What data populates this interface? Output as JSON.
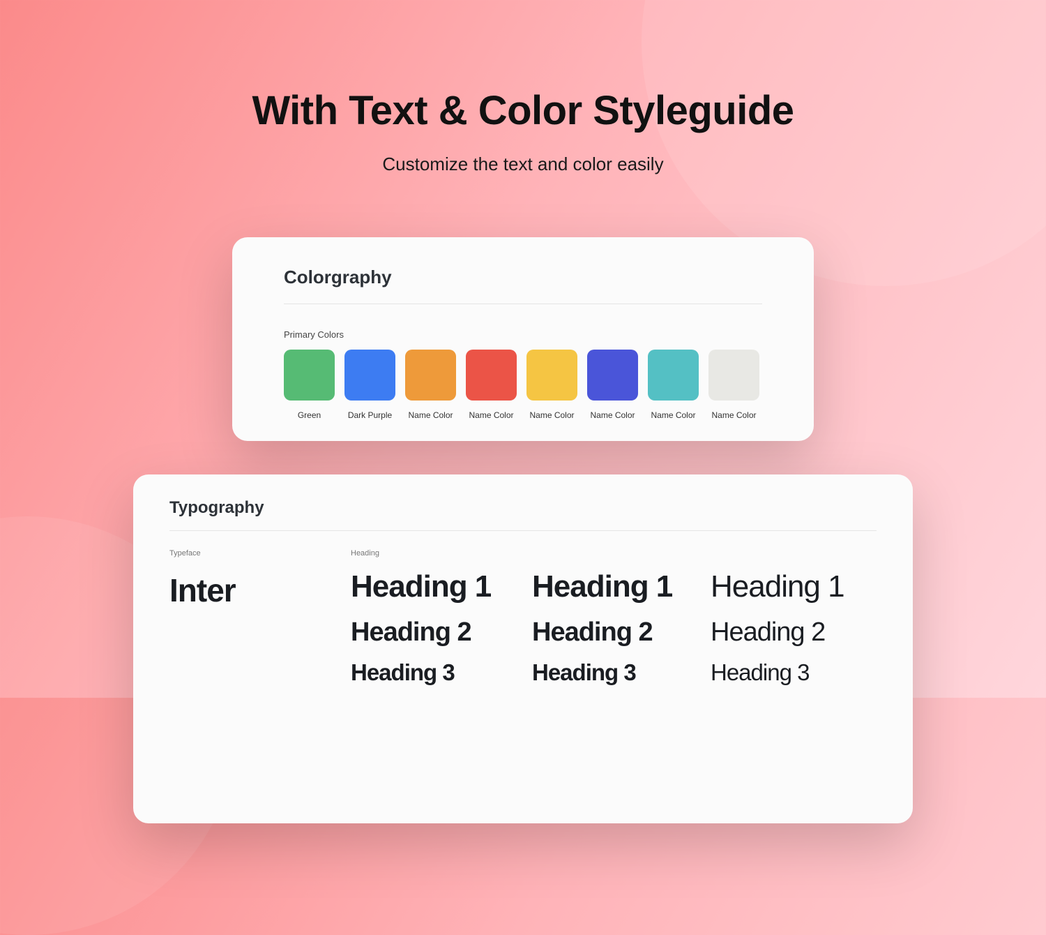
{
  "hero": {
    "title": "With Text & Color Styleguide",
    "subtitle": "Customize the text and color easily"
  },
  "colorgraphy": {
    "title": "Colorgraphy",
    "section_label": "Primary Colors",
    "swatches": [
      {
        "name": "Green",
        "hex": "#56bb74"
      },
      {
        "name": "Dark Purple",
        "hex": "#3d7cf2"
      },
      {
        "name": "Name Color",
        "hex": "#ee9a3a"
      },
      {
        "name": "Name Color",
        "hex": "#eb5447"
      },
      {
        "name": "Name Color",
        "hex": "#f5c543"
      },
      {
        "name": "Name Color",
        "hex": "#4a55d9"
      },
      {
        "name": "Name Color",
        "hex": "#54c0c4"
      },
      {
        "name": "Name Color",
        "hex": "#e8e8e4"
      }
    ]
  },
  "typography": {
    "title": "Typography",
    "typeface_label": "Typeface",
    "typeface_name": "Inter",
    "heading_label": "Heading",
    "samples": {
      "h1": "Heading 1",
      "h2": "Heading 2",
      "h3": "Heading 3"
    }
  }
}
